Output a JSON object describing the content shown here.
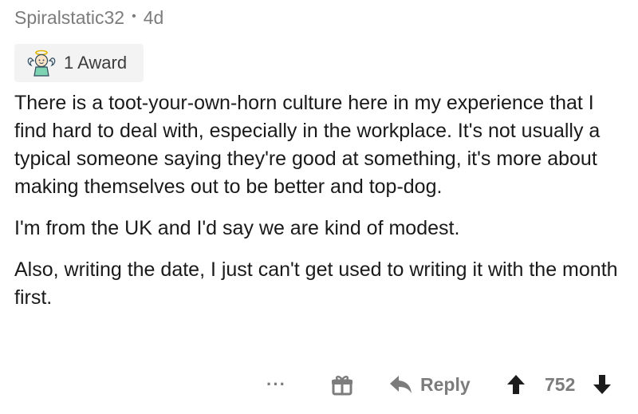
{
  "comment": {
    "author": "Spiralstatic32",
    "separator": "•",
    "age": "4d",
    "award": {
      "icon": "angel-award-icon",
      "label": "1 Award"
    },
    "paragraphs": [
      "There is a toot-your-own-horn culture here in my experience that I find hard to deal with, especially in the workplace. It's not usually a typical someone saying they're good at something, it's more about making themselves out to be better and top-dog.",
      "I'm from the UK and I'd say we are kind of modest.",
      "Also, writing the date, I just can't get used to writing it with the month first."
    ],
    "actions": {
      "more_label": "···",
      "gift_icon": "gift-icon",
      "reply_icon": "reply-arrow-icon",
      "reply_label": "Reply",
      "upvote_icon": "upvote-arrow-icon",
      "score": "752",
      "downvote_icon": "downvote-arrow-icon"
    },
    "colors": {
      "meta_text": "#7c7c7c",
      "body_text": "#1a1a1b",
      "award_bg": "#f3f3f3",
      "action_icon": "#7c7c7c"
    }
  }
}
